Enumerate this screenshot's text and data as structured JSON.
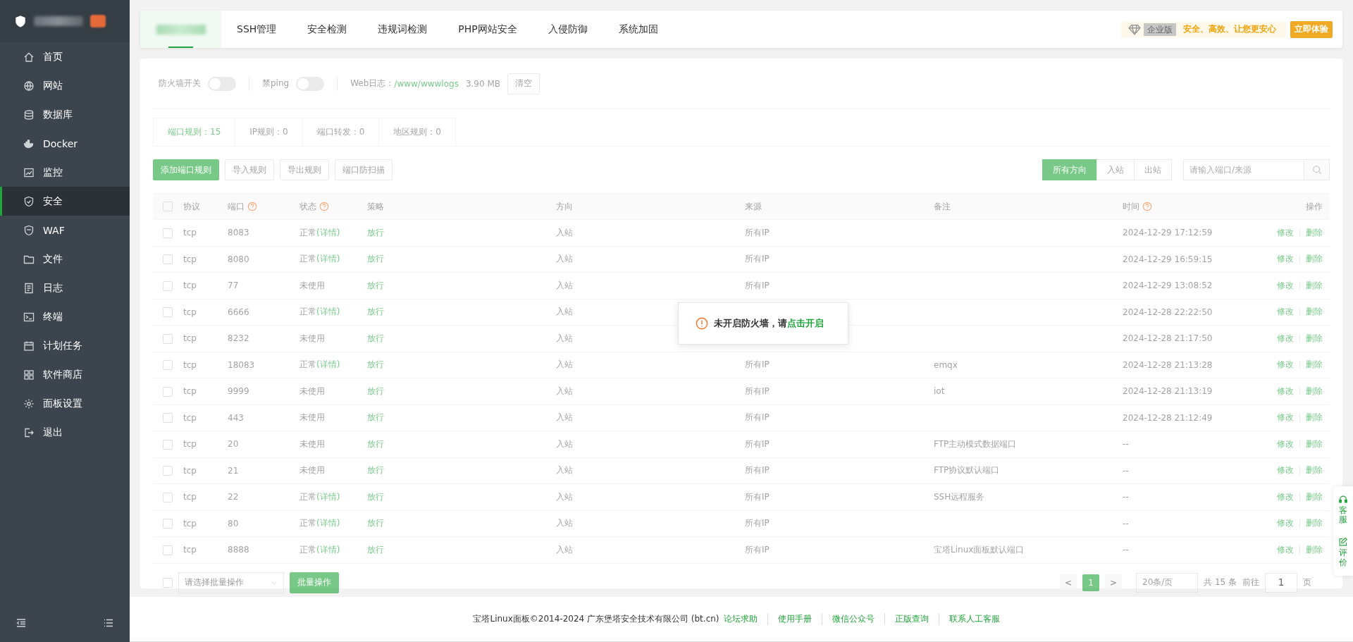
{
  "sidebar": {
    "items": [
      {
        "label": "首页",
        "selected": false
      },
      {
        "label": "网站",
        "selected": false
      },
      {
        "label": "数据库",
        "selected": false
      },
      {
        "label": "Docker",
        "selected": false
      },
      {
        "label": "监控",
        "selected": false
      },
      {
        "label": "安全",
        "selected": true
      },
      {
        "label": "WAF",
        "selected": false
      },
      {
        "label": "文件",
        "selected": false
      },
      {
        "label": "日志",
        "selected": false
      },
      {
        "label": "终端",
        "selected": false
      },
      {
        "label": "计划任务",
        "selected": false
      },
      {
        "label": "软件商店",
        "selected": false
      },
      {
        "label": "面板设置",
        "selected": false
      },
      {
        "label": "退出",
        "selected": false
      }
    ]
  },
  "top_tabs": [
    {
      "selected": true
    },
    {
      "label": "SSH管理",
      "selected": false
    },
    {
      "label": "安全检测",
      "selected": false
    },
    {
      "label": "违规词检测",
      "selected": false
    },
    {
      "label": "PHP网站安全",
      "selected": false
    },
    {
      "label": "入侵防御",
      "selected": false
    },
    {
      "label": "系统加固",
      "selected": false
    }
  ],
  "promo": {
    "badge": "企业版",
    "slogan": "安全、高效、让您更安心",
    "button": "立即体验"
  },
  "settings": {
    "firewall_label": "防火墙开关",
    "firewall_on": false,
    "ping_label": "禁ping",
    "ping_on": false,
    "log_label": "Web日志：",
    "log_path": "/www/wwwlogs",
    "log_size": "3.90 MB",
    "clear_button": "清空"
  },
  "rule_tabs": [
    {
      "label": "端口规则：15",
      "selected": true
    },
    {
      "label": "IP规则：0",
      "selected": false
    },
    {
      "label": "端口转发：0",
      "selected": false
    },
    {
      "label": "地区规则：0",
      "selected": false
    }
  ],
  "actions": [
    "添加端口规则",
    "导入规则",
    "导出规则",
    "端口防扫描"
  ],
  "direction_filter": [
    {
      "label": "所有方向",
      "selected": true
    },
    {
      "label": "入站",
      "selected": false
    },
    {
      "label": "出站",
      "selected": false
    }
  ],
  "search": {
    "placeholder": "请输入端口/来源"
  },
  "table": {
    "select_all_checked": false,
    "columns": [
      {
        "label": "协议",
        "help": false
      },
      {
        "label": "端口",
        "help": true
      },
      {
        "label": "状态",
        "help": true
      },
      {
        "label": "策略",
        "help": false
      },
      {
        "label": "方向",
        "help": false
      },
      {
        "label": "来源",
        "help": false
      },
      {
        "label": "备注",
        "help": false
      },
      {
        "label": "时间",
        "help": true
      },
      {
        "label": "操作",
        "help": false
      }
    ],
    "rows": [
      {
        "checked": false,
        "protocol": "tcp",
        "port": "8083",
        "status": "正常",
        "detail": "(详情)",
        "policy": "放行",
        "direction": "入站",
        "source": "所有IP",
        "note": "",
        "time": "2024-12-29 17:12:59",
        "edit": "修改",
        "delete": "删除"
      },
      {
        "checked": false,
        "protocol": "tcp",
        "port": "8080",
        "status": "正常",
        "detail": "(详情)",
        "policy": "放行",
        "direction": "入站",
        "source": "所有IP",
        "note": "",
        "time": "2024-12-29 16:59:15",
        "edit": "修改",
        "delete": "删除"
      },
      {
        "checked": false,
        "protocol": "tcp",
        "port": "77",
        "status": "未使用",
        "detail": "",
        "policy": "放行",
        "direction": "入站",
        "source": "所有IP",
        "note": "",
        "time": "2024-12-29 13:08:52",
        "edit": "修改",
        "delete": "删除"
      },
      {
        "checked": false,
        "protocol": "tcp",
        "port": "6666",
        "status": "正常",
        "detail": "(详情)",
        "policy": "放行",
        "direction": "入站",
        "source": "",
        "note": "",
        "time": "2024-12-28 22:22:50",
        "edit": "修改",
        "delete": "删除"
      },
      {
        "checked": false,
        "protocol": "tcp",
        "port": "8232",
        "status": "未使用",
        "detail": "",
        "policy": "放行",
        "direction": "入站",
        "source": "",
        "note": "",
        "time": "2024-12-28 21:17:50",
        "edit": "修改",
        "delete": "删除"
      },
      {
        "checked": false,
        "protocol": "tcp",
        "port": "18083",
        "status": "正常",
        "detail": "(详情)",
        "policy": "放行",
        "direction": "入站",
        "source": "所有IP",
        "note": "emqx",
        "time": "2024-12-28 21:13:28",
        "edit": "修改",
        "delete": "删除"
      },
      {
        "checked": false,
        "protocol": "tcp",
        "port": "9999",
        "status": "未使用",
        "detail": "",
        "policy": "放行",
        "direction": "入站",
        "source": "所有IP",
        "note": "iot",
        "time": "2024-12-28 21:13:19",
        "edit": "修改",
        "delete": "删除"
      },
      {
        "checked": false,
        "protocol": "tcp",
        "port": "443",
        "status": "未使用",
        "detail": "",
        "policy": "放行",
        "direction": "入站",
        "source": "所有IP",
        "note": "",
        "time": "2024-12-28 21:12:49",
        "edit": "修改",
        "delete": "删除"
      },
      {
        "checked": false,
        "protocol": "tcp",
        "port": "20",
        "status": "未使用",
        "detail": "",
        "policy": "放行",
        "direction": "入站",
        "source": "所有IP",
        "note": "FTP主动模式数据端口",
        "time": "--",
        "edit": "修改",
        "delete": "删除"
      },
      {
        "checked": false,
        "protocol": "tcp",
        "port": "21",
        "status": "未使用",
        "detail": "",
        "policy": "放行",
        "direction": "入站",
        "source": "所有IP",
        "note": "FTP协议默认端口",
        "time": "--",
        "edit": "修改",
        "delete": "删除"
      },
      {
        "checked": false,
        "protocol": "tcp",
        "port": "22",
        "status": "正常",
        "detail": "(详情)",
        "policy": "放行",
        "direction": "入站",
        "source": "所有IP",
        "note": "SSH远程服务",
        "time": "--",
        "edit": "修改",
        "delete": "删除"
      },
      {
        "checked": false,
        "protocol": "tcp",
        "port": "80",
        "status": "正常",
        "detail": "(详情)",
        "policy": "放行",
        "direction": "入站",
        "source": "所有IP",
        "note": "",
        "time": "--",
        "edit": "修改",
        "delete": "删除"
      },
      {
        "checked": false,
        "protocol": "tcp",
        "port": "8888",
        "status": "正常",
        "detail": "(详情)",
        "policy": "放行",
        "direction": "入站",
        "source": "所有IP",
        "note": "宝塔Linux面板默认端口",
        "time": "--",
        "edit": "修改",
        "delete": "删除"
      }
    ]
  },
  "batch": {
    "select_all_checked": false,
    "placeholder": "请选择批量操作",
    "button": "批量操作"
  },
  "pagination": {
    "prev": "<",
    "page": "1",
    "next": ">",
    "page_size": "20条/页",
    "total": "共 15 条",
    "goto_label": "前往",
    "goto_value": "1",
    "goto_unit": "页"
  },
  "toast": {
    "message": "未开启防火墙，请",
    "link": "点击开启"
  },
  "float_panel": [
    {
      "label": "客服"
    },
    {
      "label": "评价"
    }
  ],
  "footer": {
    "copyright": "宝塔Linux面板©2014-2024 广东堡塔安全技术有限公司 (bt.cn)",
    "links": [
      "论坛求助",
      "使用手册",
      "微信公众号",
      "正版查询",
      "联系人工客服"
    ]
  }
}
